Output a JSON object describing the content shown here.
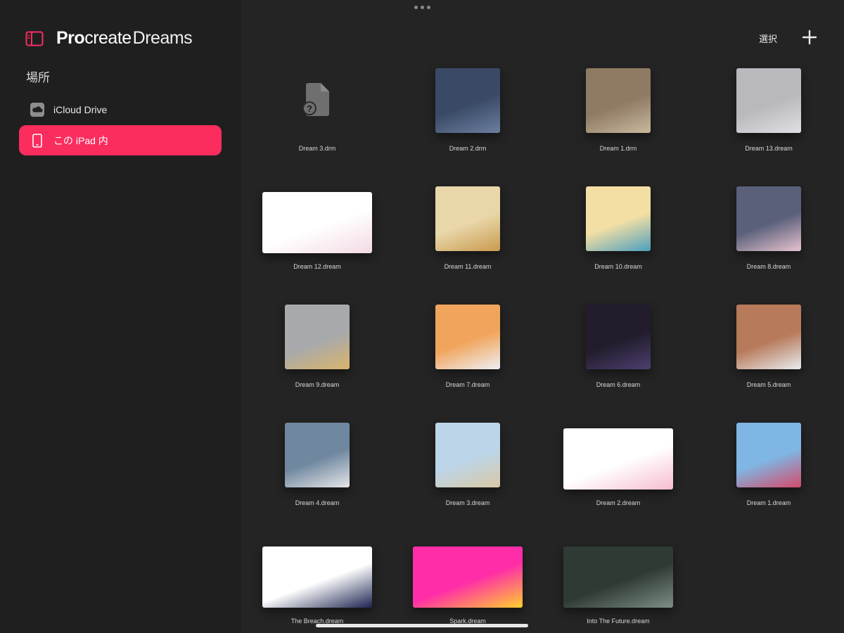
{
  "app": {
    "brand_pro": "Pro",
    "brand_create": "create",
    "brand_dreams": "Dreams",
    "accent": "#fa2d5e"
  },
  "sidebar": {
    "section_title": "場所",
    "locations": [
      {
        "label": "iCloud Drive",
        "icon": "cloud-icon",
        "selected": false
      },
      {
        "label": "この iPad 内",
        "icon": "ipad-icon",
        "selected": true
      }
    ]
  },
  "toolbar": {
    "select_label": "選択",
    "add_icon": "plus-icon"
  },
  "files": [
    {
      "name": "Dream 3.drm",
      "thumb": "missing",
      "colors": [
        "#7a7a7a"
      ]
    },
    {
      "name": "Dream 2.drm",
      "thumb": "square",
      "colors": [
        "#3a4a66",
        "#6b7fa0"
      ]
    },
    {
      "name": "Dream 1.drm",
      "thumb": "square",
      "colors": [
        "#8f7a63",
        "#c9b89e"
      ]
    },
    {
      "name": "Dream 13.dream",
      "thumb": "square",
      "colors": [
        "#b9b9bd",
        "#e0dfe3"
      ]
    },
    {
      "name": "Dream 12.dream",
      "thumb": "wide",
      "colors": [
        "#ffffff",
        "#f3d9e4"
      ]
    },
    {
      "name": "Dream 11.dream",
      "thumb": "square",
      "colors": [
        "#e9d7a9",
        "#c99a4e"
      ]
    },
    {
      "name": "Dream 10.dream",
      "thumb": "square",
      "colors": [
        "#f3dfa3",
        "#4d9fbf"
      ]
    },
    {
      "name": "Dream 8.dream",
      "thumb": "square",
      "colors": [
        "#5a5f7a",
        "#e7c3d0"
      ]
    },
    {
      "name": "Dream 9.dream",
      "thumb": "square",
      "colors": [
        "#a7a9ad",
        "#d9b56b"
      ]
    },
    {
      "name": "Dream 7.dream",
      "thumb": "square",
      "colors": [
        "#f1a55c",
        "#eef0f5"
      ]
    },
    {
      "name": "Dream 6.dream",
      "thumb": "square",
      "colors": [
        "#221c2c",
        "#4d3f70"
      ]
    },
    {
      "name": "Dream 5.dream",
      "thumb": "square",
      "colors": [
        "#b77a5a",
        "#e8ecef"
      ]
    },
    {
      "name": "Dream 4.dream",
      "thumb": "square",
      "colors": [
        "#6f879f",
        "#e6e6e8"
      ]
    },
    {
      "name": "Dream 3.dream",
      "thumb": "square",
      "colors": [
        "#bcd5e9",
        "#d9c9a6"
      ]
    },
    {
      "name": "Dream 2.dream",
      "thumb": "wide",
      "colors": [
        "#ffffff",
        "#f6bcd0"
      ]
    },
    {
      "name": "Dream 1.dream",
      "thumb": "square",
      "colors": [
        "#7fb6e3",
        "#d44a6a"
      ]
    },
    {
      "name": "The Breach.dream",
      "thumb": "wide",
      "colors": [
        "#ffffff",
        "#1c2450"
      ]
    },
    {
      "name": "Spark.dream",
      "thumb": "wide",
      "colors": [
        "#ff2ea8",
        "#ffd02e"
      ]
    },
    {
      "name": "Into The Future.dream",
      "thumb": "wide",
      "colors": [
        "#2e3a33",
        "#7d8f85"
      ]
    }
  ]
}
